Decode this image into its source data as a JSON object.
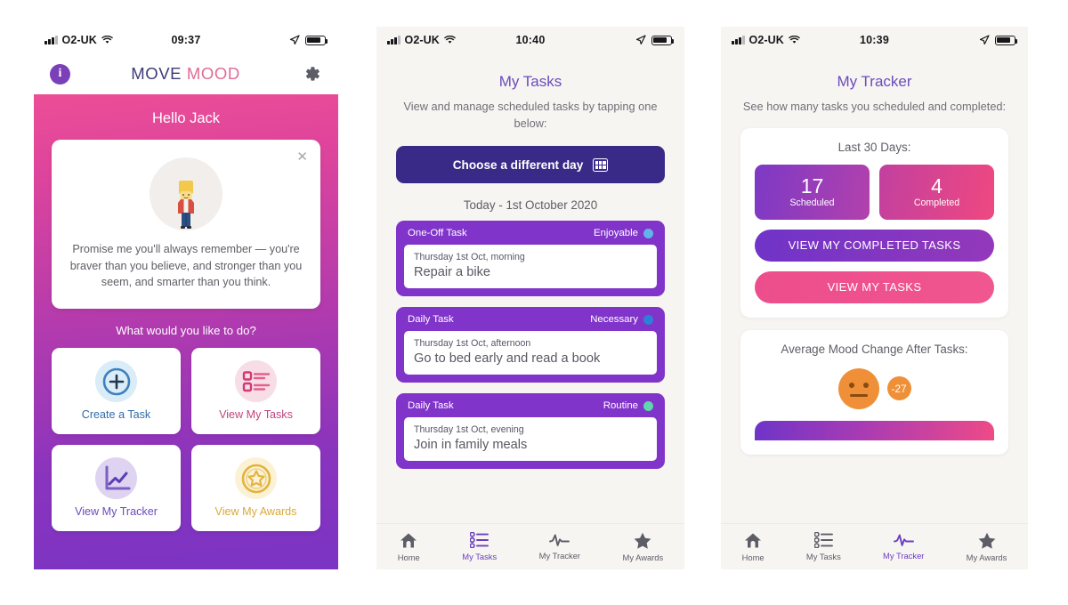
{
  "phone1": {
    "status": {
      "carrier": "O2-UK",
      "time": "09:37",
      "wifi_icon": "wifi-icon",
      "location_icon": "location-arrow-icon",
      "battery_icon": "battery-icon"
    },
    "header": {
      "info_icon": "info-icon",
      "brand_first": "MOVE",
      "brand_second": "MOOD",
      "gear_icon": "gear-icon"
    },
    "greeting": "Hello Jack",
    "quote": {
      "close_icon": "close-icon",
      "avatar_icon": "avatar-character-icon",
      "text": "Promise me you'll always remember — you're braver than you believe, and stronger than you seem, and smarter than you think."
    },
    "prompt": "What would you like to do?",
    "tiles": [
      {
        "label": "Create a Task",
        "icon": "plus-circle-icon"
      },
      {
        "label": "View My Tasks",
        "icon": "task-list-icon"
      },
      {
        "label": "View My Tracker",
        "icon": "line-chart-icon"
      },
      {
        "label": "View My Awards",
        "icon": "star-medal-icon"
      }
    ]
  },
  "phone2": {
    "status": {
      "carrier": "O2-UK",
      "time": "10:40",
      "wifi_icon": "wifi-icon",
      "location_icon": "location-arrow-icon",
      "battery_icon": "battery-icon"
    },
    "title": "My Tasks",
    "subtitle": "View and manage scheduled tasks by tapping one below:",
    "choose_day_button": {
      "label": "Choose a different day",
      "icon": "calendar-icon"
    },
    "date_heading": "Today - 1st October 2020",
    "tasks": [
      {
        "type": "One-Off Task",
        "tag": "Enjoyable",
        "tag_color": "#62b4e8",
        "when": "Thursday 1st Oct, morning",
        "name": "Repair a bike"
      },
      {
        "type": "Daily Task",
        "tag": "Necessary",
        "tag_color": "#2d80d8",
        "when": "Thursday 1st Oct, afternoon",
        "name": "Go to bed early and read a book"
      },
      {
        "type": "Daily Task",
        "tag": "Routine",
        "tag_color": "#5fd6ad",
        "when": "Thursday 1st Oct, evening",
        "name": "Join in family meals"
      }
    ],
    "nav": [
      {
        "label": "Home",
        "icon": "home-icon",
        "active": false
      },
      {
        "label": "My Tasks",
        "icon": "task-list-icon",
        "active": true
      },
      {
        "label": "My Tracker",
        "icon": "pulse-line-icon",
        "active": false
      },
      {
        "label": "My Awards",
        "icon": "star-icon",
        "active": false
      }
    ]
  },
  "phone3": {
    "status": {
      "carrier": "O2-UK",
      "time": "10:39",
      "wifi_icon": "wifi-icon",
      "location_icon": "location-arrow-icon",
      "battery_icon": "battery-icon"
    },
    "title": "My Tracker",
    "subtitle": "See how many tasks you scheduled and completed:",
    "stats_panel": {
      "heading": "Last 30 Days:",
      "scheduled_value": "17",
      "scheduled_label": "Scheduled",
      "completed_value": "4",
      "completed_label": "Completed",
      "completed_tasks_button": "VIEW MY COMPLETED TASKS",
      "my_tasks_button": "VIEW MY TASKS"
    },
    "mood_panel": {
      "heading": "Average Mood Change After Tasks:",
      "face_icon": "neutral-face-icon",
      "badge_value": "-27"
    },
    "nav": [
      {
        "label": "Home",
        "icon": "home-icon",
        "active": false
      },
      {
        "label": "My Tasks",
        "icon": "task-list-icon",
        "active": false
      },
      {
        "label": "My Tracker",
        "icon": "pulse-line-icon",
        "active": true
      },
      {
        "label": "My Awards",
        "icon": "star-icon",
        "active": false
      }
    ]
  }
}
